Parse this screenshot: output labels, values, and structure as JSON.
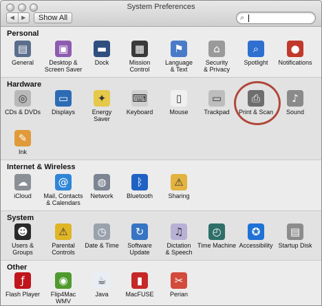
{
  "window": {
    "title": "System Preferences"
  },
  "toolbar": {
    "back_label": "◀",
    "forward_label": "▶",
    "show_all_label": "Show All",
    "search_value": ""
  },
  "sections": {
    "personal": {
      "title": "Personal",
      "items": [
        {
          "label": "General",
          "icon": "general-icon",
          "color": "#5b6e8c"
        },
        {
          "label": "Desktop &\nScreen Saver",
          "icon": "desktop-icon",
          "color": "#8e5bb0"
        },
        {
          "label": "Dock",
          "icon": "dock-icon",
          "color": "#2f4f7f"
        },
        {
          "label": "Mission\nControl",
          "icon": "mission-control-icon",
          "color": "#3a3a3a"
        },
        {
          "label": "Language\n& Text",
          "icon": "language-icon",
          "color": "#4a7bc8"
        },
        {
          "label": "Security\n& Privacy",
          "icon": "security-icon",
          "color": "#9a9a9a"
        },
        {
          "label": "Spotlight",
          "icon": "spotlight-icon",
          "color": "#2f6fd0"
        },
        {
          "label": "Notifications",
          "icon": "notifications-icon",
          "color": "#c0392b"
        }
      ]
    },
    "hardware": {
      "title": "Hardware",
      "items": [
        {
          "label": "CDs & DVDs",
          "icon": "cd-icon",
          "color": "#b8b8b8"
        },
        {
          "label": "Displays",
          "icon": "displays-icon",
          "color": "#2d6cb5"
        },
        {
          "label": "Energy\nSaver",
          "icon": "energy-icon",
          "color": "#e6c84a"
        },
        {
          "label": "Keyboard",
          "icon": "keyboard-icon",
          "color": "#d0d0d0"
        },
        {
          "label": "Mouse",
          "icon": "mouse-icon",
          "color": "#f0f0f0"
        },
        {
          "label": "Trackpad",
          "icon": "trackpad-icon",
          "color": "#bdbdbd"
        },
        {
          "label": "Print & Scan",
          "icon": "printer-icon",
          "color": "#6e6e6e"
        },
        {
          "label": "Sound",
          "icon": "sound-icon",
          "color": "#8a8a8a"
        },
        {
          "label": "Ink",
          "icon": "ink-icon",
          "color": "#e09a3a"
        }
      ]
    },
    "internet": {
      "title": "Internet & Wireless",
      "items": [
        {
          "label": "iCloud",
          "icon": "icloud-icon",
          "color": "#8a8f96"
        },
        {
          "label": "Mail, Contacts\n& Calendars",
          "icon": "mail-icon",
          "color": "#2f86d6"
        },
        {
          "label": "Network",
          "icon": "network-icon",
          "color": "#7d8592"
        },
        {
          "label": "Bluetooth",
          "icon": "bluetooth-icon",
          "color": "#2061c4"
        },
        {
          "label": "Sharing",
          "icon": "sharing-icon",
          "color": "#e3b341"
        }
      ]
    },
    "system": {
      "title": "System",
      "items": [
        {
          "label": "Users &\nGroups",
          "icon": "users-icon",
          "color": "#2a2a2a"
        },
        {
          "label": "Parental\nControls",
          "icon": "parental-icon",
          "color": "#e0b526"
        },
        {
          "label": "Date & Time",
          "icon": "clock-icon",
          "color": "#9aa2ad"
        },
        {
          "label": "Software\nUpdate",
          "icon": "software-update-icon",
          "color": "#3774c4"
        },
        {
          "label": "Dictation\n& Speech",
          "icon": "dictation-icon",
          "color": "#b9b0d6"
        },
        {
          "label": "Time Machine",
          "icon": "time-machine-icon",
          "color": "#2e6f6a"
        },
        {
          "label": "Accessibility",
          "icon": "accessibility-icon",
          "color": "#1f72d6"
        },
        {
          "label": "Startup Disk",
          "icon": "startup-disk-icon",
          "color": "#8c8c8c"
        }
      ]
    },
    "other": {
      "title": "Other",
      "items": [
        {
          "label": "Flash Player",
          "icon": "flash-icon",
          "color": "#c0151b"
        },
        {
          "label": "Flip4Mac\nWMV",
          "icon": "flip4mac-icon",
          "color": "#4f9a2e"
        },
        {
          "label": "Java",
          "icon": "java-icon",
          "color": "#e9eef5"
        },
        {
          "label": "MacFUSE",
          "icon": "macfuse-icon",
          "color": "#c62828"
        },
        {
          "label": "Perian",
          "icon": "perian-icon",
          "color": "#d24b3b"
        }
      ]
    }
  }
}
